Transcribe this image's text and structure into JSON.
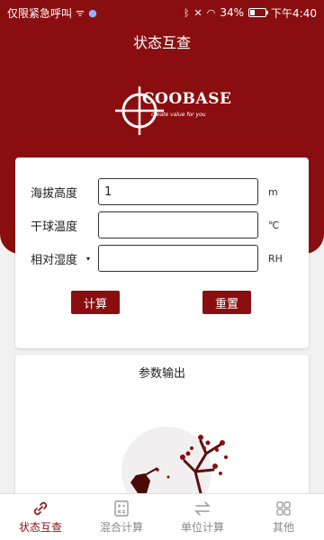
{
  "status_bar": {
    "carrier": "仅限紧急呼叫",
    "battery": "34%",
    "battery_level": 0.34,
    "time": "下午4:40"
  },
  "header": {
    "title": "状态互查"
  },
  "logo": {
    "brand": "COOBASE",
    "tagline": "create value for you"
  },
  "form": {
    "rows": [
      {
        "label": "海拔高度",
        "value": "1",
        "unit": "m"
      },
      {
        "label": "干球温度",
        "value": "",
        "unit": "℃"
      },
      {
        "label": "相对湿度",
        "value": "",
        "unit": "RH",
        "dropdown_caret": "▾"
      }
    ],
    "calc_label": "计算",
    "reset_label": "重置"
  },
  "output": {
    "title": "参数输出"
  },
  "tabbar": {
    "tabs": [
      {
        "label": "状态互查",
        "icon": "link-icon",
        "active": true
      },
      {
        "label": "混合计算",
        "icon": "calculator-icon",
        "active": false
      },
      {
        "label": "单位计算",
        "icon": "swap-arrows-icon",
        "active": false
      },
      {
        "label": "其他",
        "icon": "grid-icon",
        "active": false
      }
    ]
  },
  "colors": {
    "primary": "#8a0e10",
    "background": "#f1f1f1",
    "inactive_tab": "#888888"
  }
}
